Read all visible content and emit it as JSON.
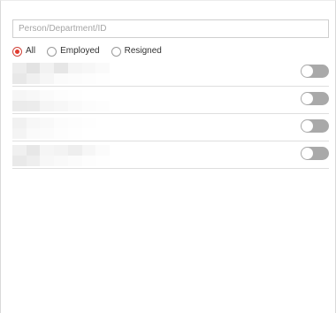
{
  "search": {
    "placeholder": "Person/Department/ID",
    "value": ""
  },
  "filter": {
    "options": [
      {
        "label": "All",
        "selected": true
      },
      {
        "label": "Employed",
        "selected": false
      },
      {
        "label": "Resigned",
        "selected": false
      }
    ]
  },
  "persons": [
    {
      "toggle_on": false
    },
    {
      "toggle_on": false
    },
    {
      "toggle_on": false
    },
    {
      "toggle_on": false
    }
  ],
  "colors": {
    "accent": "#e23b2f",
    "toggle_off": "#a9a9a9",
    "divider": "#dedede"
  }
}
